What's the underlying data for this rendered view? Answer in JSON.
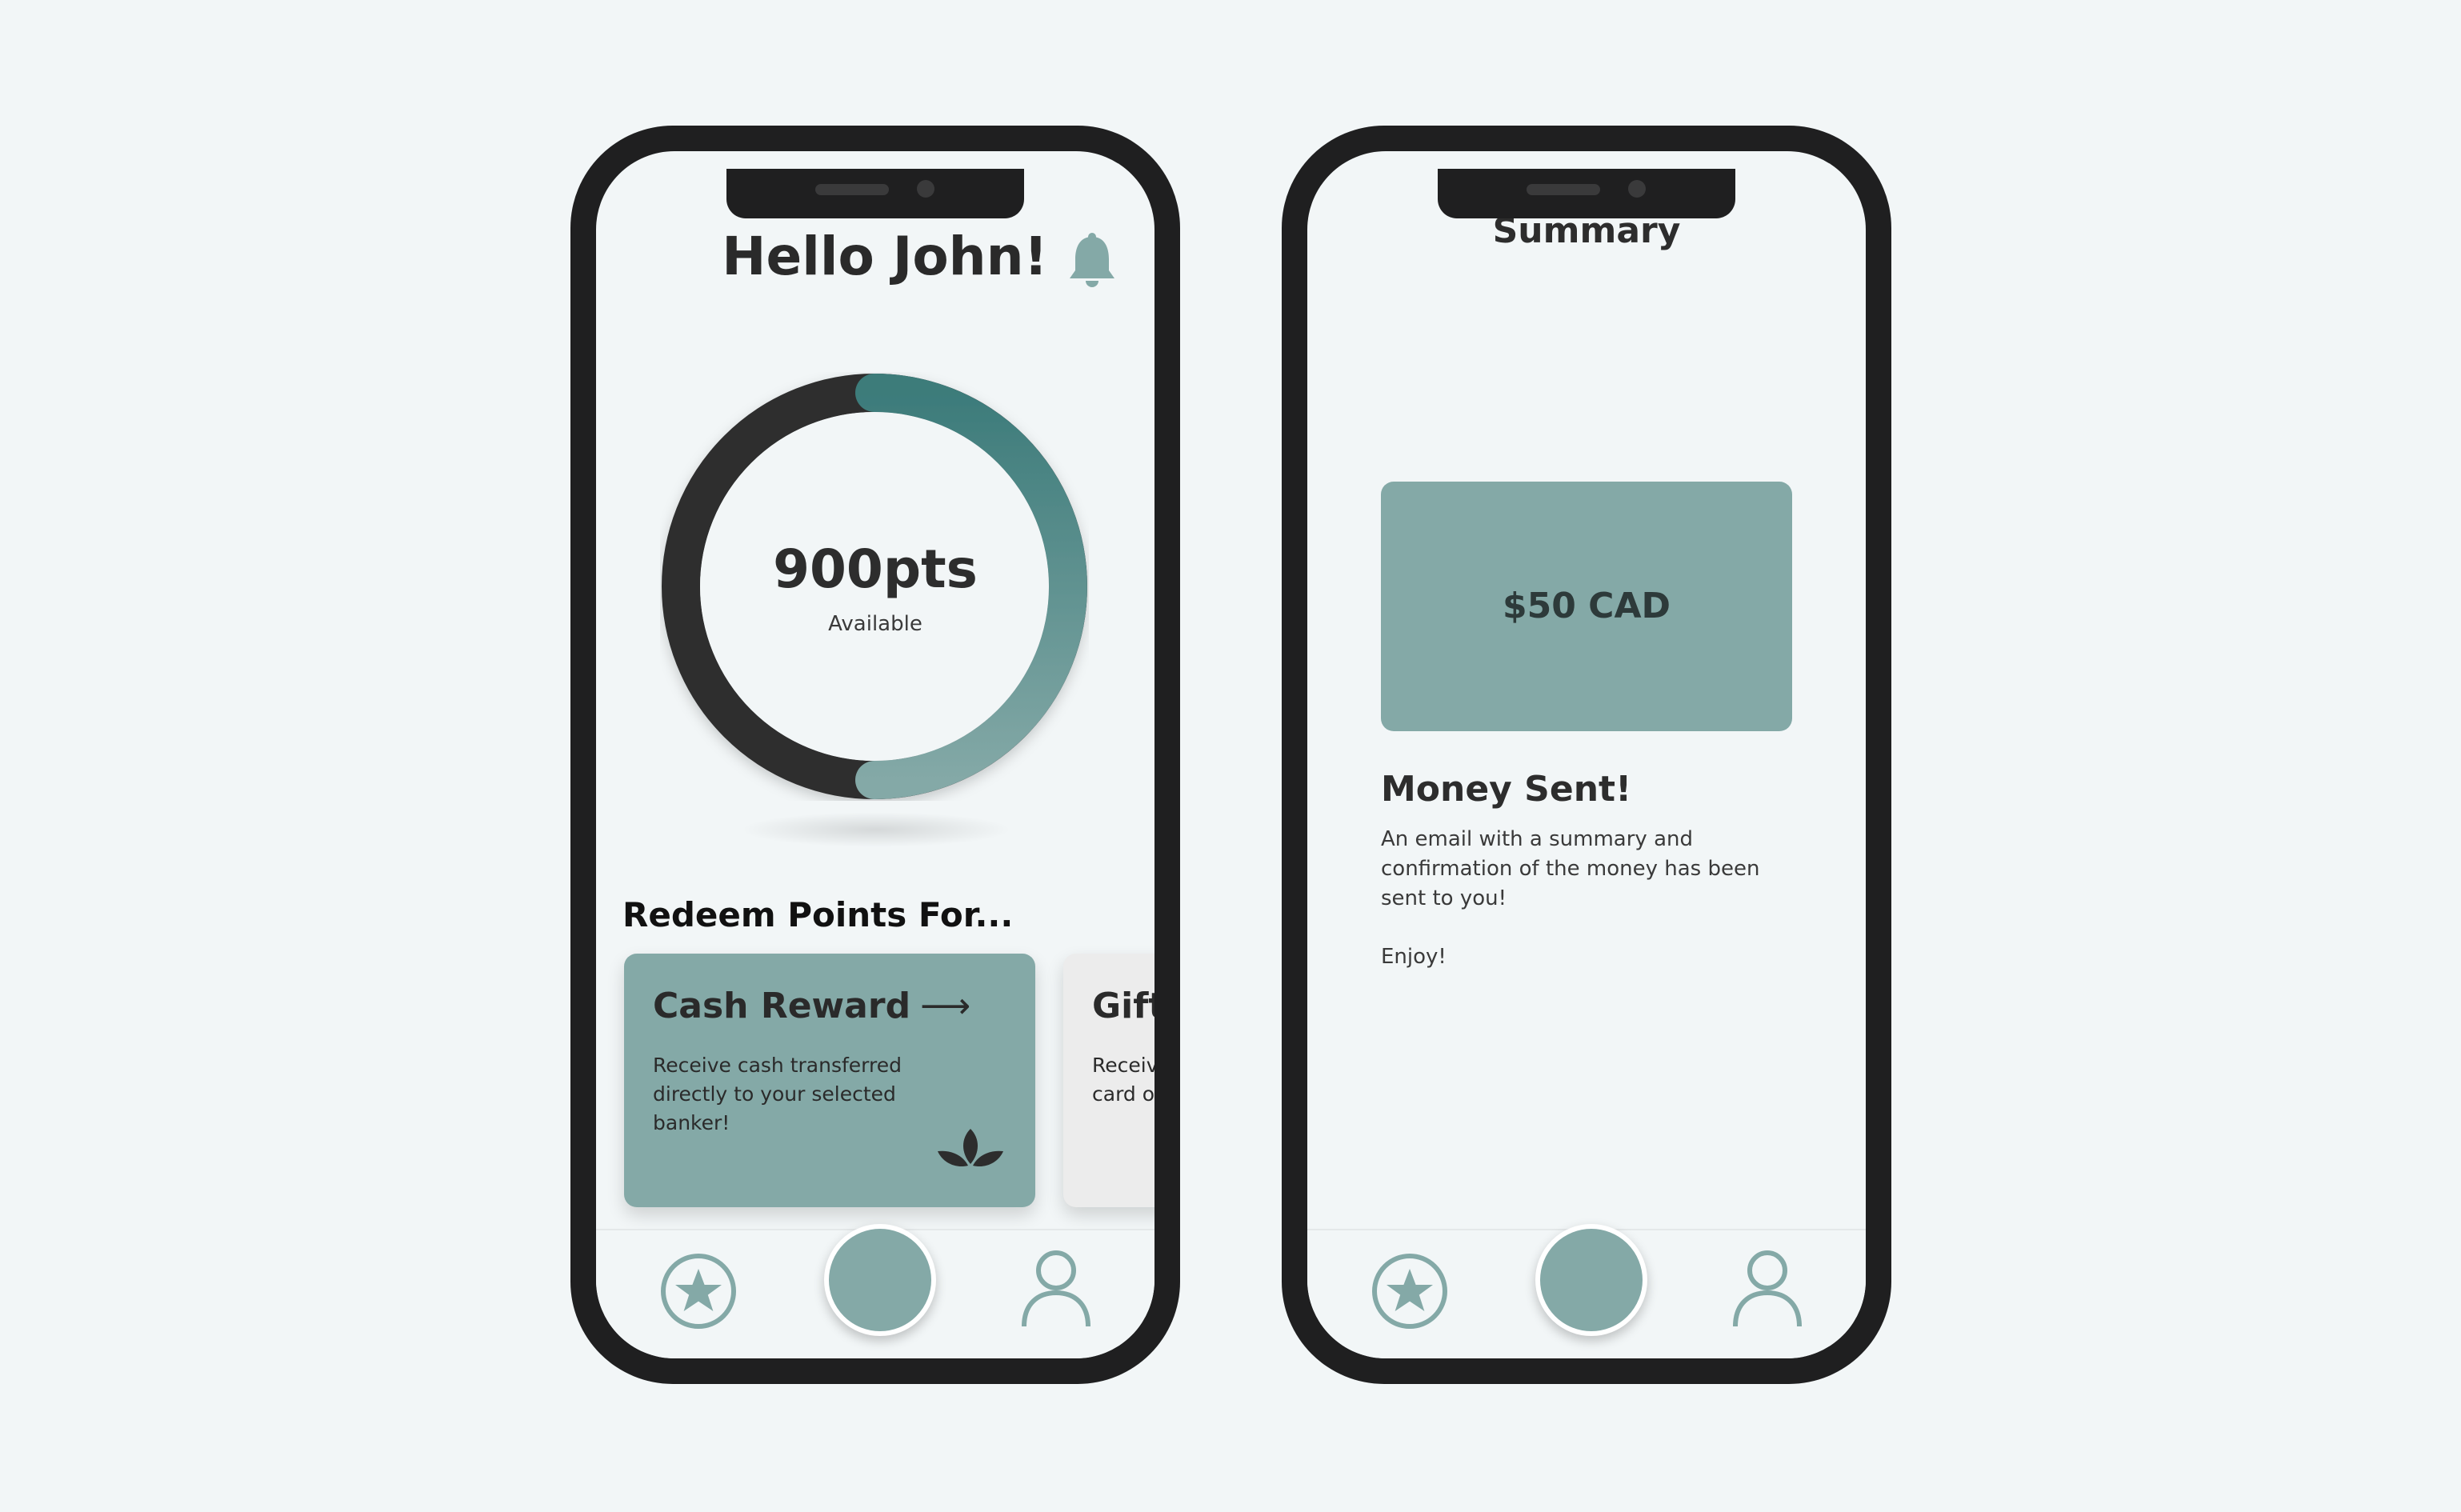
{
  "colors": {
    "background": "#f2f6f7",
    "phone_frame": "#1f1f20",
    "accent": "#84a9a7",
    "accent_dark": "#3c7b7a",
    "text": "#2d2d2d"
  },
  "home_screen": {
    "greeting": "Hello John!",
    "notification_icon": "bell-icon",
    "points": {
      "value": "900pts",
      "caption": "Available",
      "progress_fraction": 0.5
    },
    "redeem_title": "Redeem Points For...",
    "cards": [
      {
        "title": "Cash Reward",
        "arrow": "⟶",
        "description": "Receive cash transferred directly to your selected banker!",
        "icon": "leaf-icon"
      },
      {
        "title": "Gift",
        "description_line1": "Receiv",
        "description_line2": "card o"
      }
    ]
  },
  "summary_screen": {
    "title": "Summary",
    "amount": "$50 CAD",
    "confirmation_title": "Money Sent!",
    "confirmation_text": "An email with a summary and confirmation of the money has been sent to you!",
    "closing": "Enjoy!"
  },
  "bottom_nav": {
    "left_icon": "star-circle-icon",
    "center_icon": "home-button",
    "right_icon": "user-icon"
  }
}
